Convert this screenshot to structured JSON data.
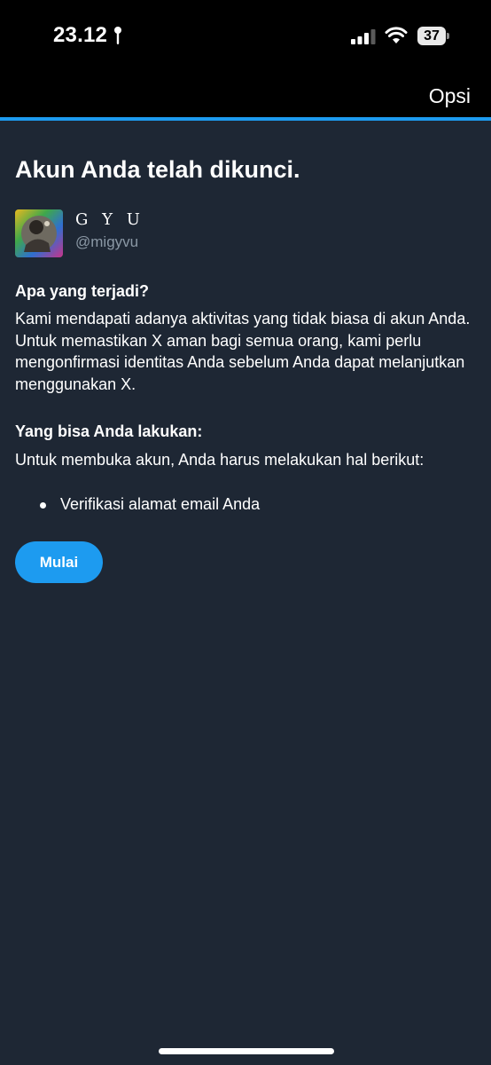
{
  "status_bar": {
    "time": "23.12",
    "battery_level": "37",
    "signal_bars_active": 3,
    "icons": [
      "location-pin-icon",
      "signal-icon",
      "wifi-icon",
      "battery-icon"
    ]
  },
  "nav": {
    "options_label": "Opsi"
  },
  "colors": {
    "accent": "#1d9bf0",
    "background": "#1e2734",
    "header": "#000000",
    "secondary_text": "#8b98a5"
  },
  "page": {
    "title": "Akun Anda telah dikunci."
  },
  "account": {
    "display_name": "G Y U",
    "handle": "@migyvu"
  },
  "what_happened": {
    "heading": "Apa yang terjadi?",
    "body": "Kami mendapati adanya aktivitas yang tidak biasa di akun Anda. Untuk memastikan X aman bagi semua orang, kami perlu mengonfirmasi identitas Anda sebelum Anda dapat melanjutkan menggunakan X."
  },
  "what_you_can_do": {
    "heading": "Yang bisa Anda lakukan:",
    "body": "Untuk membuka akun, Anda harus melakukan hal berikut:",
    "steps": [
      "Verifikasi alamat email Anda"
    ]
  },
  "actions": {
    "start_label": "Mulai"
  }
}
